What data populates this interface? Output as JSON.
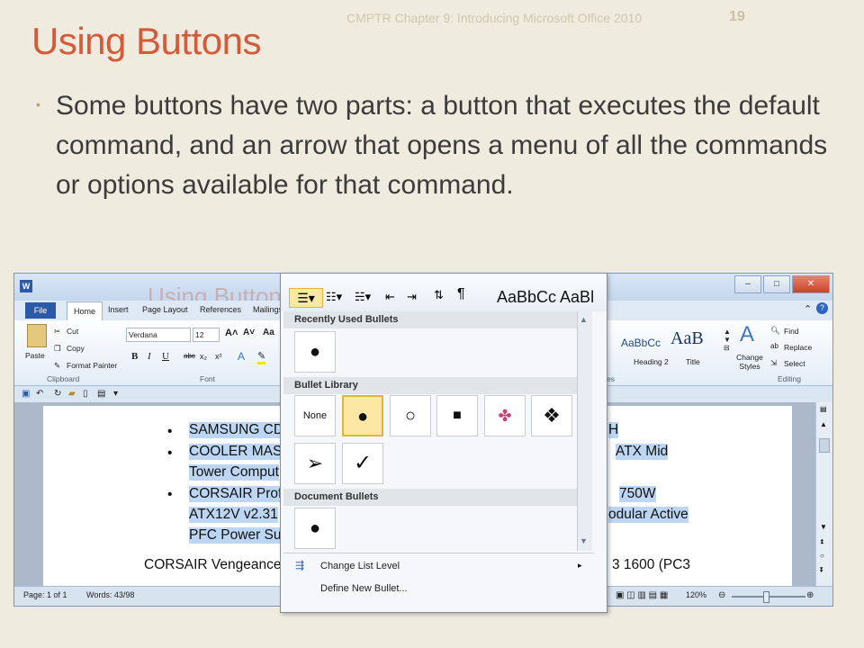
{
  "slide": {
    "header": "CMPTR Chapter 9: Introducing Microsoft Office 2010",
    "number": "19",
    "title": "Using Buttons",
    "bullet": "Some buttons have two parts: a button that executes the default command, and an arrow that opens a menu of all the commands or options available for that command."
  },
  "word": {
    "ghost_title": "Using Buttons",
    "tabs": {
      "file": "File",
      "home": "Home",
      "insert": "Insert",
      "page_layout": "Page Layout",
      "references": "References",
      "mailings": "Mailings"
    },
    "clipboard": {
      "paste": "Paste",
      "cut": "Cut",
      "copy": "Copy",
      "format_painter": "Format Painter",
      "label": "Clipboard"
    },
    "font": {
      "name": "Verdana",
      "size": "12",
      "label": "Font"
    },
    "styles": {
      "sample1": "AaBbCc",
      "sample2": "AaB",
      "heading2": "Heading 2",
      "title": "Title",
      "change_styles": "Change Styles",
      "label": "es"
    },
    "editing": {
      "find": "Find",
      "replace": "Replace",
      "select": "Select",
      "label": "Editing"
    },
    "doc_lines": [
      "SAMSUNG CD",
      "COOLER MAST",
      "Tower Comput",
      "CORSAIR Profe",
      "ATX12V v2.31",
      "PFC Power Sup",
      "CORSAIR Vengeance"
    ],
    "doc_right": [
      "H",
      "ATX Mid",
      "750W",
      "odular Active",
      "3 1600 (PC3"
    ],
    "status": {
      "page": "Page: 1 of 1",
      "words": "Words: 43/98",
      "zoom": "120%"
    }
  },
  "dropdown": {
    "top_sample": "AaBbCc AaBl",
    "recently_used": "Recently Used Bullets",
    "library": "Bullet Library",
    "none": "None",
    "document": "Document Bullets",
    "change_level": "Change List Level",
    "define_new": "Define New Bullet..."
  }
}
